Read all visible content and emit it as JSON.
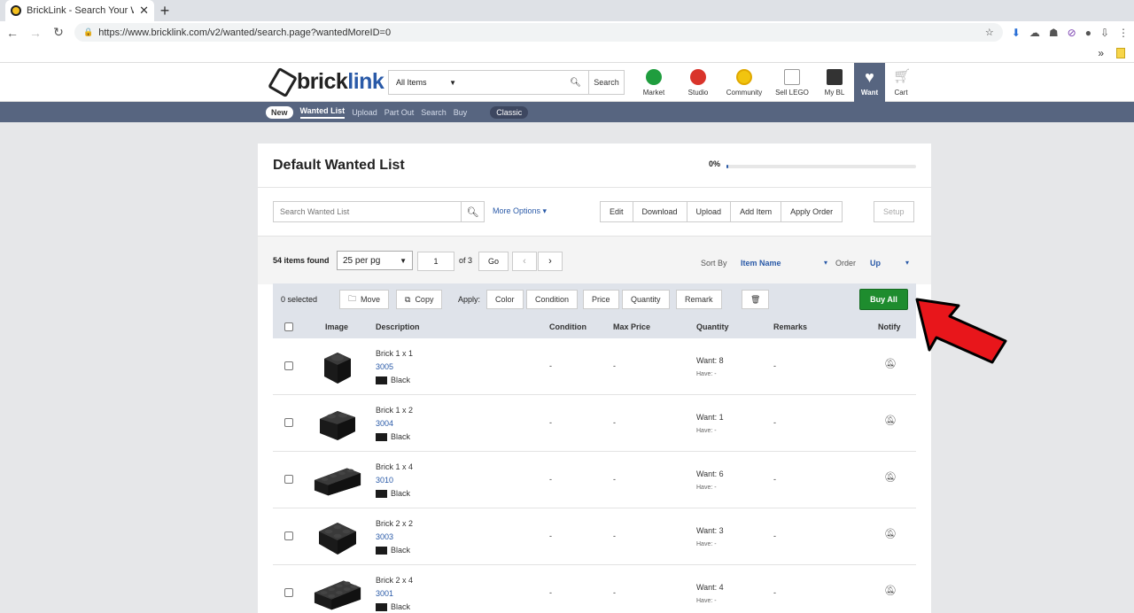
{
  "browser": {
    "tab_title": "BrickLink - Search Your Wanted L",
    "url": "https://www.bricklink.com/v2/wanted/search.page?wantedMoreID=0",
    "bookmarks_more": "»"
  },
  "header": {
    "logo_brick": "brick",
    "logo_link": "link",
    "category": "All Items",
    "search_btn": "Search",
    "nav": {
      "market": "Market",
      "studio": "Studio",
      "community": "Community",
      "sell": "Sell LEGO",
      "mybl": "My BL",
      "want": "Want",
      "cart": "Cart"
    }
  },
  "subnav": {
    "new_pill": "New",
    "items": [
      "Wanted List",
      "Upload",
      "Part Out",
      "Search",
      "Buy"
    ],
    "classic": "Classic"
  },
  "panel": {
    "title": "Default Wanted List",
    "progress_pct": "0%",
    "progress_value": 0.01,
    "search_placeholder": "Search Wanted List",
    "more_options": "More Options",
    "buttons": [
      "Edit",
      "Download",
      "Upload",
      "Add Item",
      "Apply Order"
    ],
    "setup": "Setup",
    "found": "54 items found",
    "per_page": "25 per pg",
    "page": "1",
    "of_pages": "of 3",
    "go": "Go",
    "sort_by_label": "Sort By",
    "sort_by_value": "Item Name",
    "order_label": "Order",
    "order_value": "Up"
  },
  "actions": {
    "selected": "0 selected",
    "move": "Move",
    "copy": "Copy",
    "apply_label": "Apply:",
    "apply": [
      "Color",
      "Condition",
      "Price",
      "Quantity",
      "Remark"
    ],
    "buy_all": "Buy All"
  },
  "table": {
    "columns": {
      "image": "Image",
      "description": "Description",
      "condition": "Condition",
      "max_price": "Max Price",
      "quantity": "Quantity",
      "remarks": "Remarks",
      "notify": "Notify"
    },
    "rows": [
      {
        "name": "Brick 1 x 1",
        "part": "3005",
        "color": "Black",
        "condition": "-",
        "max_price": "-",
        "want": "Want: 8",
        "have": "Have: -",
        "remarks": "-"
      },
      {
        "name": "Brick 1 x 2",
        "part": "3004",
        "color": "Black",
        "condition": "-",
        "max_price": "-",
        "want": "Want: 1",
        "have": "Have: -",
        "remarks": "-"
      },
      {
        "name": "Brick 1 x 4",
        "part": "3010",
        "color": "Black",
        "condition": "-",
        "max_price": "-",
        "want": "Want: 6",
        "have": "Have: -",
        "remarks": "-"
      },
      {
        "name": "Brick 2 x 2",
        "part": "3003",
        "color": "Black",
        "condition": "-",
        "max_price": "-",
        "want": "Want: 3",
        "have": "Have: -",
        "remarks": "-"
      },
      {
        "name": "Brick 2 x 4",
        "part": "3001",
        "color": "Black",
        "condition": "-",
        "max_price": "-",
        "want": "Want: 4",
        "have": "Have: -",
        "remarks": "-"
      }
    ]
  },
  "colors": {
    "nav_bar": "#576580",
    "link": "#2a5aa8",
    "buy_all": "#1e8c2e",
    "arrow": "#e8161b"
  }
}
